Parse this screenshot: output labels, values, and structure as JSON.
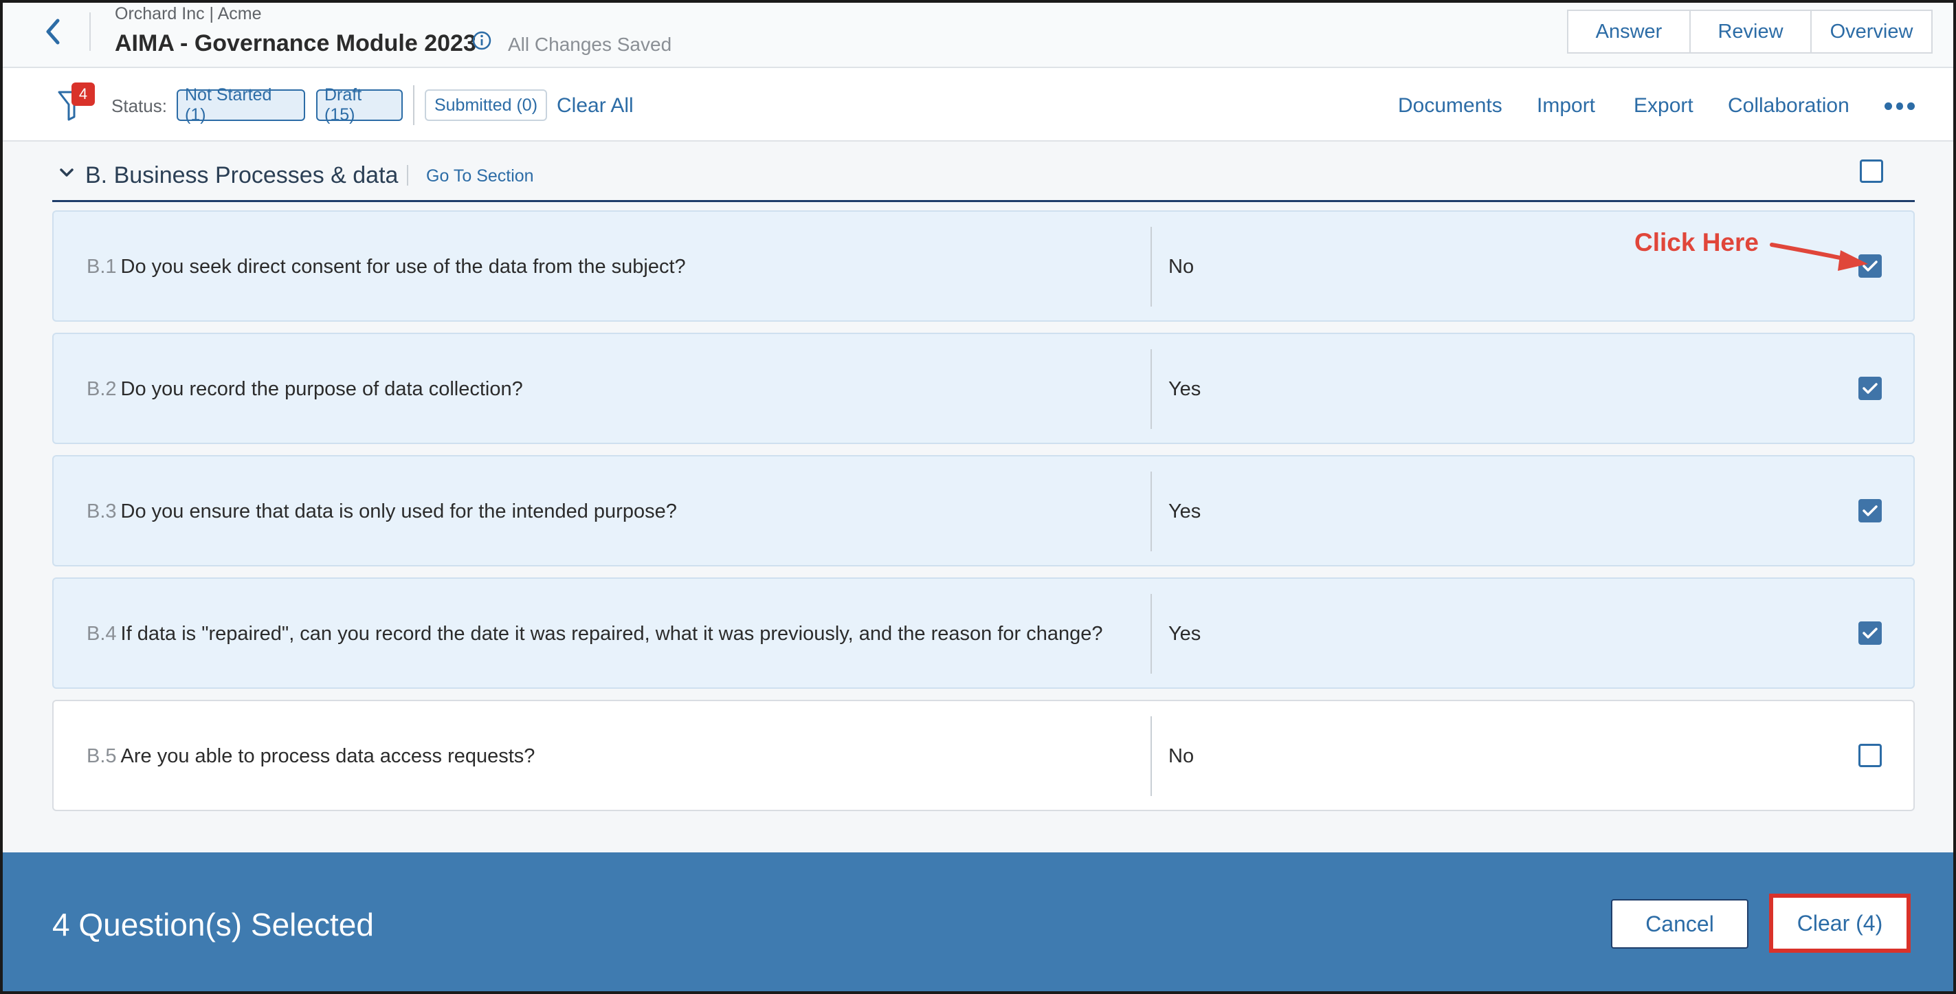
{
  "header": {
    "breadcrumb": "Orchard Inc | Acme",
    "title": "AIMA - Governance Module 2023",
    "save_status": "All Changes Saved",
    "tabs": [
      {
        "label": "Answer"
      },
      {
        "label": "Review"
      },
      {
        "label": "Overview"
      }
    ]
  },
  "toolbar": {
    "filter_badge": "4",
    "status_label": "Status:",
    "chips": [
      {
        "label": "Not Started (1)",
        "active": true
      },
      {
        "label": "Draft (15)",
        "active": true
      },
      {
        "label": "Submitted (0)",
        "active": false
      }
    ],
    "clear_all": "Clear All",
    "links": [
      "Documents",
      "Import",
      "Export",
      "Collaboration"
    ]
  },
  "section": {
    "title": "B. Business Processes & data",
    "goto_label": "Go To Section",
    "checked": false
  },
  "questions": [
    {
      "num": "B.1",
      "text": "Do you seek direct consent for use of the data from the subject?",
      "answer": "No",
      "checked": true
    },
    {
      "num": "B.2",
      "text": "Do you record the purpose of data collection?",
      "answer": "Yes",
      "checked": true
    },
    {
      "num": "B.3",
      "text": "Do you ensure that data is only used for the intended purpose?",
      "answer": "Yes",
      "checked": true
    },
    {
      "num": "B.4",
      "text": "If data is \"repaired\", can you record the date it was repaired, what it was previously, and the reason for change?",
      "answer": "Yes",
      "checked": true
    },
    {
      "num": "B.5",
      "text": "Are you able to process data access requests?",
      "answer": "No",
      "checked": false
    }
  ],
  "annotation": {
    "text": "Click Here"
  },
  "footer": {
    "selected_text": "4 Question(s) Selected",
    "cancel_label": "Cancel",
    "clear_label": "Clear (4)"
  },
  "colors": {
    "accent": "#2c6ca6",
    "footer_bg": "#3f7bb0",
    "selected_row_bg": "#e8f2fb",
    "highlight_red": "#d9322a"
  }
}
